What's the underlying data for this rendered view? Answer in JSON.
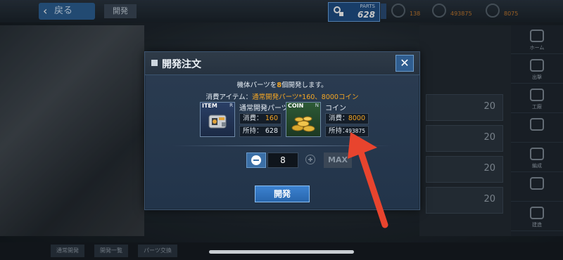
{
  "background": {
    "back_label": "戻る",
    "tab_label": "開発",
    "parts": {
      "label": "PARTS",
      "value": "628"
    },
    "resources": [
      {
        "value": "138"
      },
      {
        "value": "493875"
      },
      {
        "value": "8075"
      }
    ],
    "slot_numbers": [
      "20",
      "20",
      "20",
      "20"
    ],
    "side_nav": [
      "ホーム",
      "出撃",
      "工廠",
      "",
      "編成",
      "",
      "建造"
    ],
    "bottom_tabs": [
      "通常開発",
      "開発一覧",
      "パーツ交換"
    ]
  },
  "modal": {
    "title": "開発注文",
    "close_icon": "close-icon",
    "message_prefix": "機体パーツを",
    "message_count": "8",
    "message_suffix": "個開発します。",
    "cost_prefix": "消費アイテム：",
    "cost_highlight": "通常開発パーツ*160、8000コイン",
    "item": {
      "tag": "ITEM",
      "rank": "R",
      "name": "通常開発パーツ",
      "consume_label": "消費：",
      "consume_value": "160",
      "own_label": "所持：",
      "own_value": "628"
    },
    "coin": {
      "tag": "COIN",
      "rank": "N",
      "name": "コイン",
      "consume_label": "消費：",
      "consume_value": "8000",
      "own_label": "所持：",
      "own_value": "493875"
    },
    "quantity": "8",
    "max_label": "MAX",
    "develop_label": "開発"
  },
  "colors": {
    "accent_orange": "#f5a623",
    "annotation_red": "#e8442e",
    "button_blue": "#3c82d0"
  }
}
